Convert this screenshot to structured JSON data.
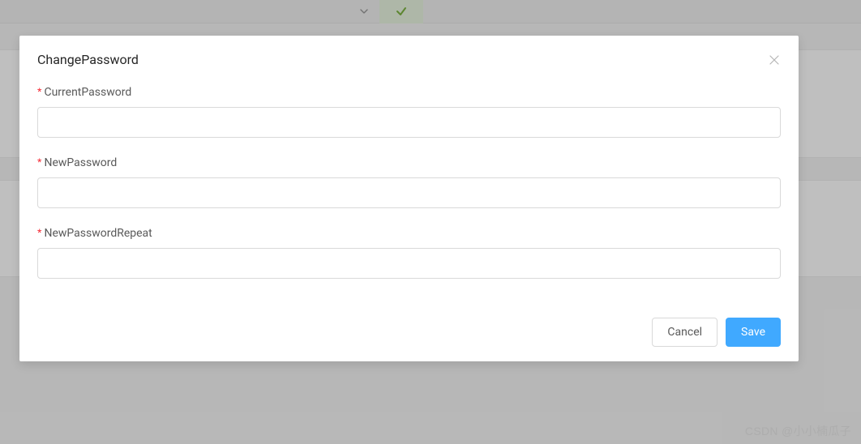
{
  "modal": {
    "title": "ChangePassword",
    "fields": {
      "current": {
        "label": "CurrentPassword",
        "value": ""
      },
      "new": {
        "label": "NewPassword",
        "value": ""
      },
      "repeat": {
        "label": "NewPasswordRepeat",
        "value": ""
      }
    },
    "buttons": {
      "cancel": "Cancel",
      "save": "Save"
    }
  },
  "watermark": "CSDN @小小楠瓜子"
}
